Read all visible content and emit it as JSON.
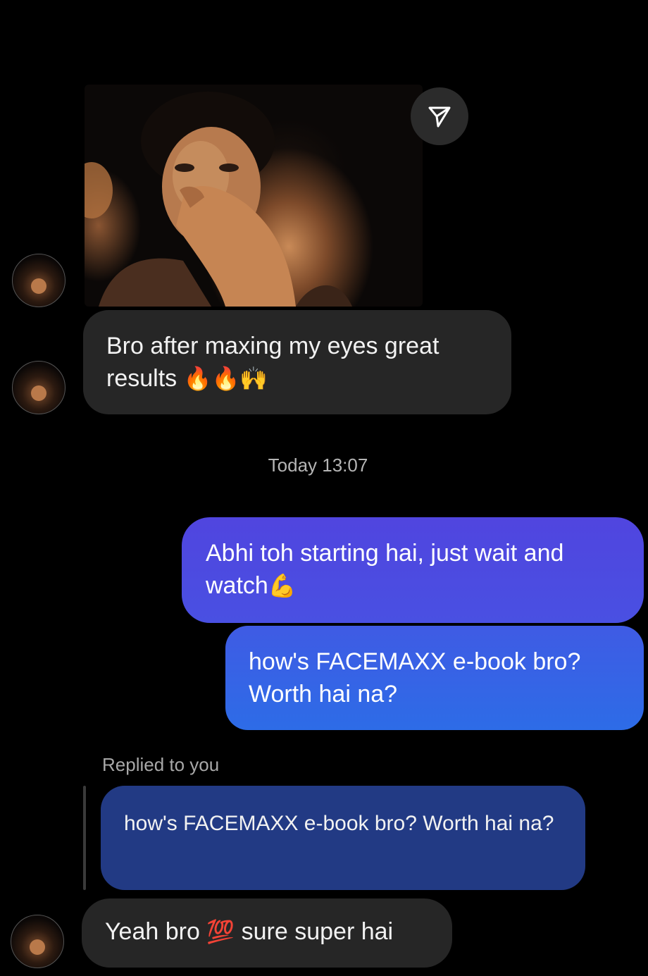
{
  "thread": {
    "messages": [
      {
        "sender": "other",
        "type": "photo"
      },
      {
        "sender": "other",
        "text": "Bro after maxing my eyes great results",
        "emojis": "🔥🔥🙌"
      },
      {
        "sender": "me",
        "text": "Abhi toh starting hai, just wait and watch",
        "emojis": "💪"
      },
      {
        "sender": "me",
        "text_line1": "how's FACEMAXX e-book bro?",
        "text_line2": "Worth hai na?"
      },
      {
        "sender": "other",
        "reply_to": "how's FACEMAXX e-book bro? Worth hai na?",
        "text_before": "Yeah bro",
        "emoji": "💯",
        "text_after": "sure super hai"
      }
    ],
    "timestamp": "Today 13:07",
    "replied_label": "Replied to you"
  },
  "icons": {
    "share": "send-arrow-icon",
    "avatar": "contact-avatar"
  },
  "colors": {
    "background": "#000000",
    "incoming_bubble": "#262626",
    "outgoing_gradient_top": "#5146e0",
    "outgoing_gradient_bottom": "#2f6ae8",
    "quoted_bubble": "#223a84"
  }
}
